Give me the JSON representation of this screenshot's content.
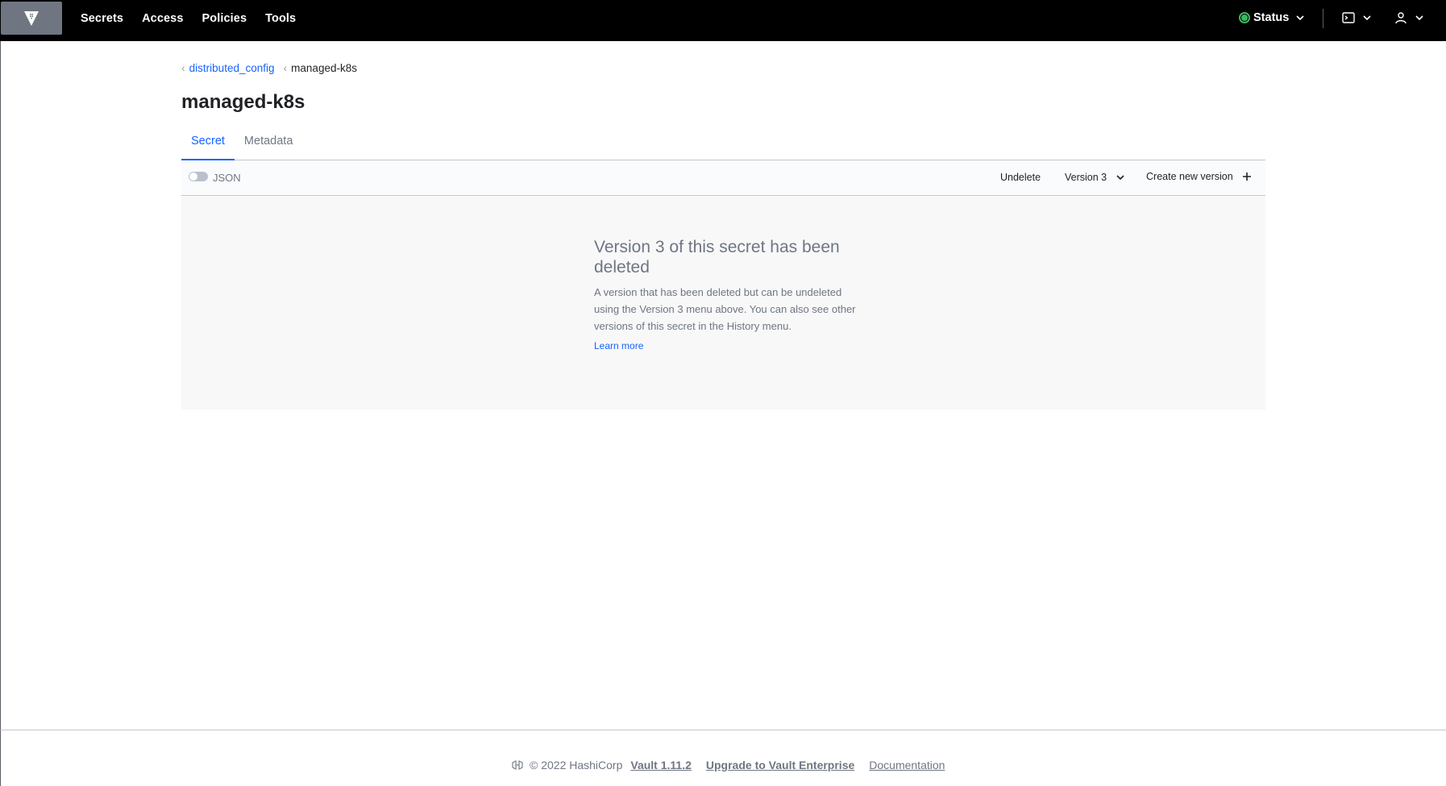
{
  "nav": {
    "links": [
      "Secrets",
      "Access",
      "Policies",
      "Tools"
    ],
    "status_label": "Status",
    "status_color": "#3cb95f"
  },
  "breadcrumb": {
    "parent": "distributed_config",
    "current": "managed-k8s"
  },
  "page": {
    "title": "managed-k8s",
    "tabs": [
      {
        "label": "Secret",
        "active": true
      },
      {
        "label": "Metadata",
        "active": false
      }
    ]
  },
  "toolbar": {
    "json_toggle_label": "JSON",
    "json_toggle_on": false,
    "undelete_label": "Undelete",
    "version_label": "Version 3",
    "create_label": "Create new version"
  },
  "empty_state": {
    "title": "Version 3 of this secret has been deleted",
    "body": "A version that has been deleted but can be undeleted using the Version 3 menu above. You can also see other versions of this secret in the History menu.",
    "link": "Learn more"
  },
  "footer": {
    "copyright": "© 2022 HashiCorp",
    "version_link": "Vault 1.11.2",
    "upgrade_link": "Upgrade to Vault Enterprise",
    "docs_link": "Documentation"
  },
  "colors": {
    "accent": "#1563ff",
    "nav_bg": "#000000",
    "logo_bg": "#6f7682"
  },
  "icons": {
    "logo": "vault-logo-icon",
    "status": "status-ok-icon",
    "console": "terminal-icon",
    "user": "user-icon",
    "chevron": "chevron-down-icon",
    "crumb": "chevron-left-icon",
    "plus": "plus-icon",
    "footer": "hashicorp-logo-icon"
  }
}
